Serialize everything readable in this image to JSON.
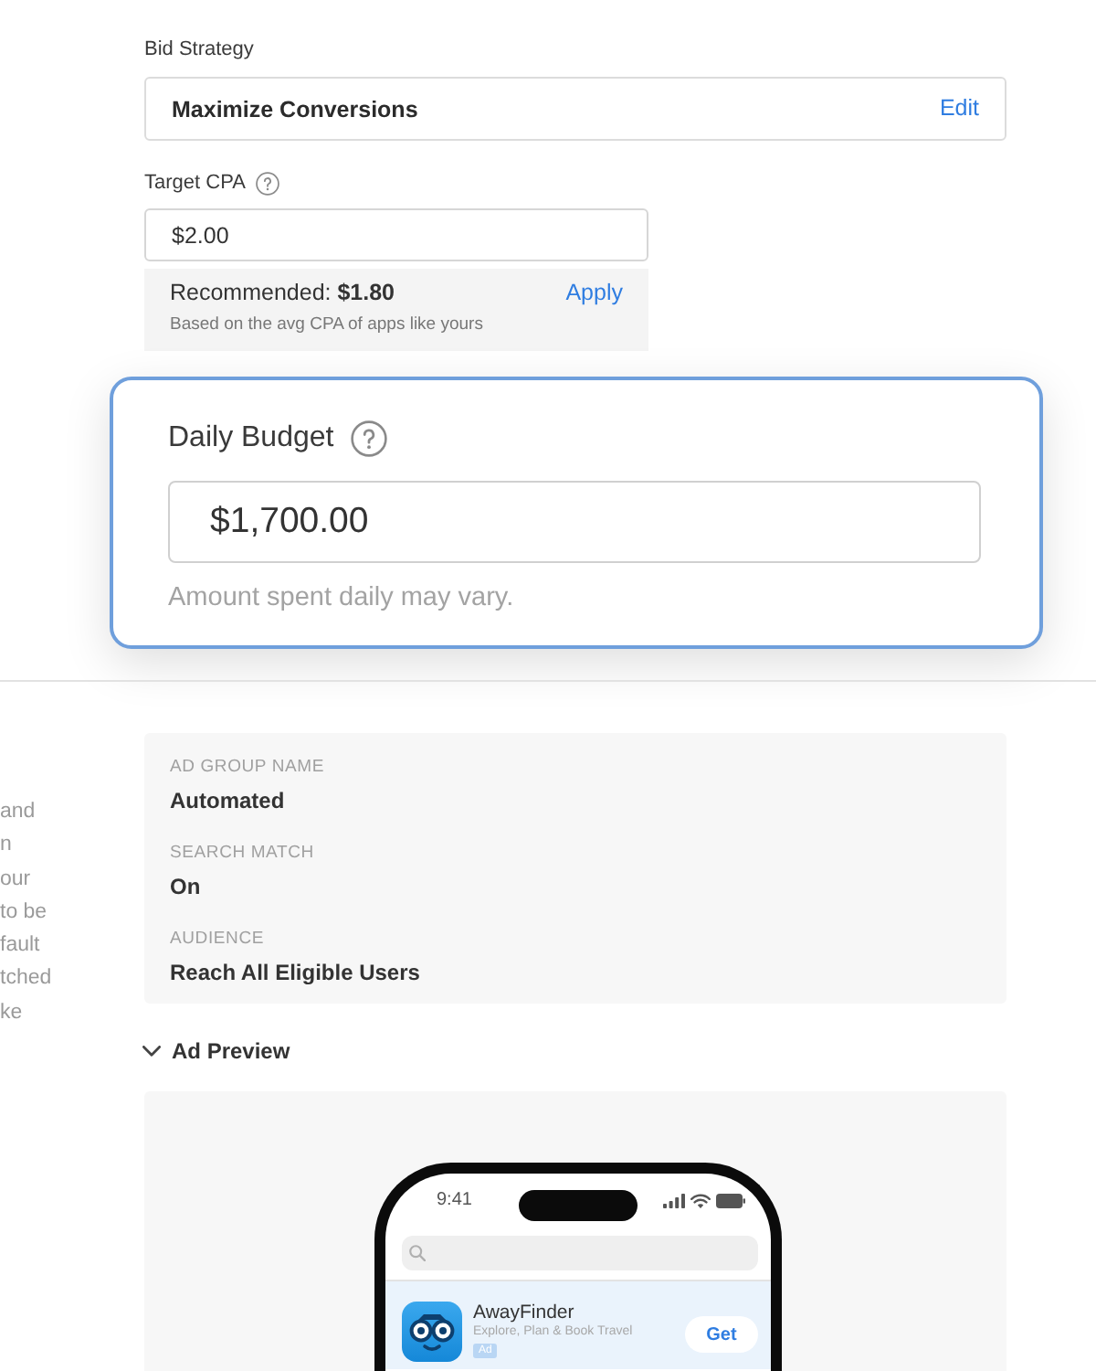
{
  "bid_strategy": {
    "label": "Bid Strategy",
    "value": "Maximize Conversions",
    "action": "Edit"
  },
  "target_cpa": {
    "label": "Target CPA",
    "value": "$2.00",
    "recommendation": {
      "text": "Recommended: **$1.80**",
      "action": "Apply",
      "note": "Based on the avg CPA of apps like yours"
    }
  },
  "daily_budget": {
    "label": "Daily Budget",
    "value": "$1,700.00",
    "hint": "Amount spent daily may vary.",
    "focused": true
  },
  "side_text_lines": [
    "and",
    "n",
    "our",
    "to be",
    "fault",
    "tched",
    "ke"
  ],
  "ad_group": [
    {
      "label": "AD GROUP NAME",
      "value": "Automated"
    },
    {
      "label": "SEARCH MATCH",
      "value": "On"
    },
    {
      "label": "AUDIENCE",
      "value": "Reach All Eligible Users"
    }
  ],
  "ad_preview": {
    "title": "Ad Preview",
    "expanded": true,
    "phone": {
      "time": "9:41",
      "app": {
        "name": "AwayFinder",
        "subtitle": "Explore, Plan & Book Travel",
        "badge": "Ad",
        "action": "Get"
      }
    }
  }
}
